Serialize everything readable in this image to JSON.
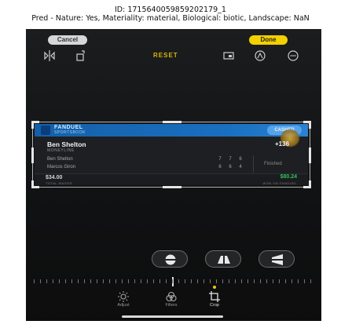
{
  "caption": {
    "line1": "ID: 1715640059859202179_1",
    "line2": "Pred - Nature: Yes, Materiality: material, Biological: biotic, Landscape: NaN"
  },
  "top_bar": {
    "cancel_label": "Cancel",
    "done_label": "Done"
  },
  "toolbar": {
    "reset_label": "RESET",
    "icons": [
      "flip-icon",
      "rotate-icon",
      "aspect-ratio-icon",
      "auto-icon",
      "more-icon"
    ]
  },
  "ticket": {
    "brand": "FANDUEL",
    "brand_sub": "SPORTSBOOK",
    "badge": "CASHED",
    "player": "Ben Shelton",
    "market": "MONEYLINE",
    "odds": "+136",
    "rows": [
      {
        "name": "Ben Shelton",
        "scores": [
          "7",
          "7",
          "6"
        ]
      },
      {
        "name": "Marcos Giron",
        "scores": [
          "6",
          "6",
          "4"
        ]
      }
    ],
    "status": "Finished",
    "wager": "$34.00",
    "wager_label": "TOTAL WAGER",
    "won": "$80.24",
    "won_label": "WON ON FANDUEL"
  },
  "perspective_buttons": [
    "straighten-icon",
    "vertical-perspective-icon",
    "horizontal-perspective-icon"
  ],
  "modes": [
    {
      "label": "Adjust",
      "icon": "adjust-icon"
    },
    {
      "label": "Filters",
      "icon": "filters-icon"
    },
    {
      "label": "Crop",
      "icon": "crop-icon",
      "active": true
    }
  ],
  "colors": {
    "accent": "#f4d000",
    "won_green": "#2ec15a",
    "fanduel_blue": "#1a6fc0"
  }
}
